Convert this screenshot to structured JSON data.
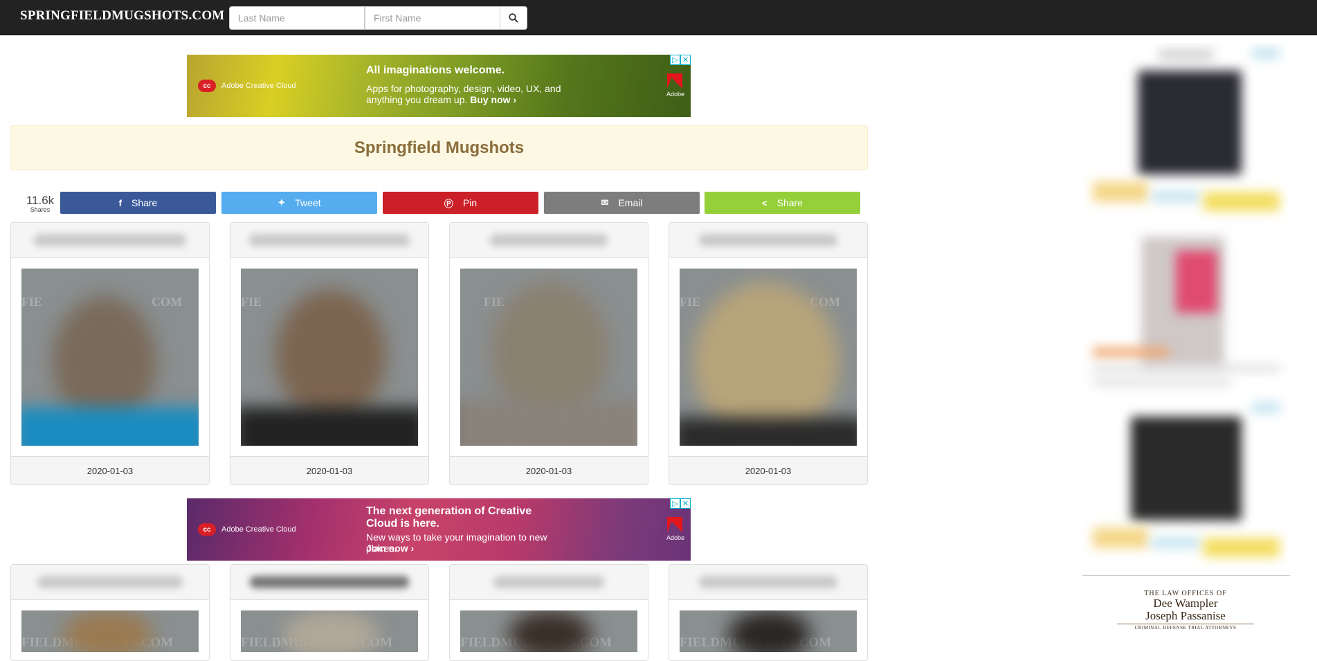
{
  "navbar": {
    "brand": "SPRINGFIELDMUGSHOTS.COM",
    "last_name_placeholder": "Last Name",
    "first_name_placeholder": "First Name",
    "search_icon": "search-icon"
  },
  "ad_top": {
    "brand": "Adobe Creative Cloud",
    "headline": "All imaginations welcome.",
    "body": "Apps for photography, design, video, UX, and anything you dream up.",
    "cta": "Buy now ›",
    "logo_text": "Adobe"
  },
  "title": "Springfield Mugshots",
  "share": {
    "count": "11.6k",
    "count_label": "Shares",
    "buttons": [
      {
        "label": "Share",
        "icon": "facebook-icon"
      },
      {
        "label": "Tweet",
        "icon": "twitter-icon"
      },
      {
        "label": "Pin",
        "icon": "pinterest-icon"
      },
      {
        "label": "Email",
        "icon": "email-icon"
      },
      {
        "label": "Share",
        "icon": "share-icon"
      }
    ]
  },
  "mugshots_row1": [
    {
      "date": "2020-01-03"
    },
    {
      "date": "2020-01-03"
    },
    {
      "date": "2020-01-03"
    },
    {
      "date": "2020-01-03"
    }
  ],
  "watermark": "FIE",
  "watermark_right": "COM",
  "watermark_row2": "FIELDMUGSHOTS.COM",
  "ad_bottom": {
    "brand": "Adobe Creative Cloud",
    "headline": "The next generation of Creative Cloud is here.",
    "body": "New ways to take your imagination to new places.",
    "cta": "Join now ›",
    "logo_text": "Adobe"
  },
  "sidebar_ad": {
    "line1": "THE LAW OFFICES OF",
    "line2": "Dee Wampler",
    "line3": "Joseph Passanise",
    "line4": "CRIMINAL DEFENSE TRIAL ATTORNEYS"
  }
}
